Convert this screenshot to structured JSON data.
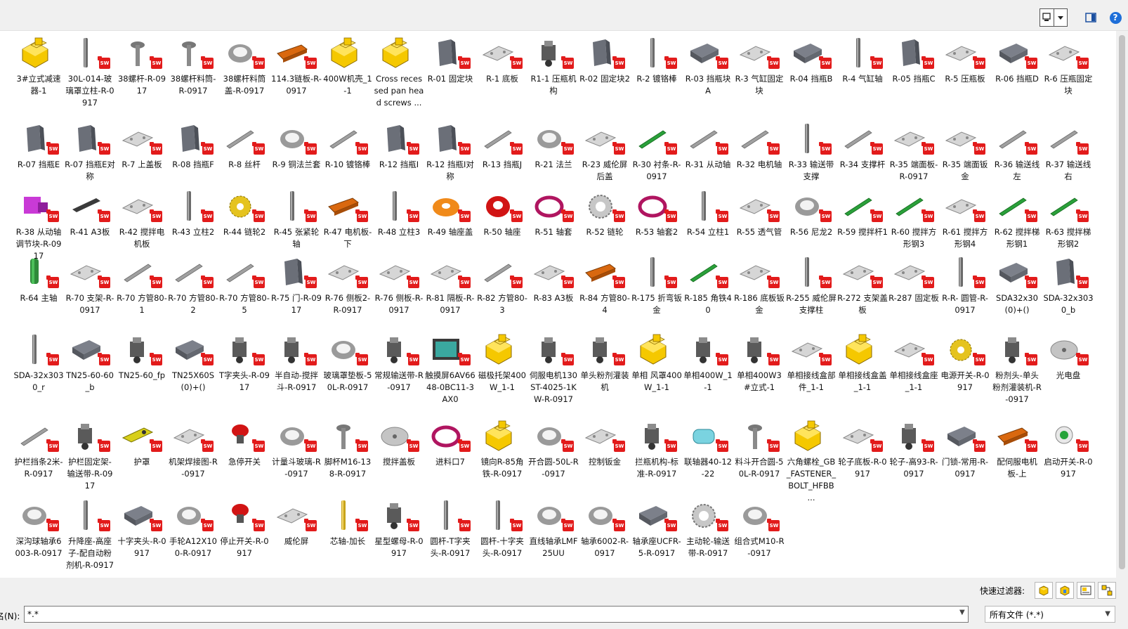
{
  "toolbar": {
    "view_icon": "view-mode-icon",
    "dropdown_icon": "chevron-down-icon",
    "preview_pane_icon": "preview-pane-icon",
    "help_label": "?"
  },
  "colors": {
    "sw_badge": "#e21b1b",
    "help": "#1e6fd9",
    "selection": "#ffffff"
  },
  "files": [
    {
      "name": "3#立式减速器-1",
      "kind": "asm"
    },
    {
      "name": "30L-014-玻璃罩立柱-R-0917",
      "kind": "rod"
    },
    {
      "name": "38螺杆-R-0917",
      "kind": "screw"
    },
    {
      "name": "38螺杆料筒-R-0917",
      "kind": "screw"
    },
    {
      "name": "38螺杆料筒盖-R-0917",
      "kind": "ring"
    },
    {
      "name": "114.3链板-R-0917",
      "kind": "orange"
    },
    {
      "name": "400W机壳_1-1",
      "kind": "asm"
    },
    {
      "name": "Cross recessed pan head screws ...",
      "kind": "asm"
    },
    {
      "name": "R-01 固定块",
      "kind": "block"
    },
    {
      "name": "R-1 底板",
      "kind": "plate"
    },
    {
      "name": "R1-1 压瓶机构",
      "kind": "mech"
    },
    {
      "name": "R-02 固定块2",
      "kind": "block"
    },
    {
      "name": "R-2 镀铬棒",
      "kind": "rod"
    },
    {
      "name": "R-03 挡瓶块A",
      "kind": "dark"
    },
    {
      "name": "R-3 气缸固定块",
      "kind": "plate"
    },
    {
      "name": "R-04 挡瓶B",
      "kind": "dark"
    },
    {
      "name": "R-4 气缸轴",
      "kind": "rod"
    },
    {
      "name": "R-05 挡瓶C",
      "kind": "block"
    },
    {
      "name": "R-5 压瓶板",
      "kind": "plate"
    },
    {
      "name": "R-06 挡瓶D",
      "kind": "dark"
    },
    {
      "name": "R-6 压瓶固定块",
      "kind": "plate"
    },
    {
      "name": "R-07 挡瓶E",
      "kind": "block"
    },
    {
      "name": "R-07 挡瓶E对称",
      "kind": "block"
    },
    {
      "name": "R-7 上盖板",
      "kind": "plate"
    },
    {
      "name": "R-08 挡瓶F",
      "kind": "block"
    },
    {
      "name": "R-8 丝杆",
      "kind": "bar"
    },
    {
      "name": "R-9 铜法兰套",
      "kind": "ring"
    },
    {
      "name": "R-10 镀铬棒",
      "kind": "bar"
    },
    {
      "name": "R-12 挡瓶I",
      "kind": "block"
    },
    {
      "name": "R-12 挡瓶I对称",
      "kind": "block"
    },
    {
      "name": "R-13 挡瓶J",
      "kind": "bar"
    },
    {
      "name": "R-21 法兰",
      "kind": "ring"
    },
    {
      "name": "R-23 威伦屏后盖",
      "kind": "plate"
    },
    {
      "name": "R-30 衬条-R-0917",
      "kind": "greenbar"
    },
    {
      "name": "R-31 从动轴",
      "kind": "bar"
    },
    {
      "name": "R-32 电机轴",
      "kind": "bar"
    },
    {
      "name": "R-33 输送带支撑",
      "kind": "rod"
    },
    {
      "name": "R-34 支撑杆",
      "kind": "bar"
    },
    {
      "name": "R-35 端面板-R-0917",
      "kind": "plate"
    },
    {
      "name": "R-35 端面钣金",
      "kind": "plate"
    },
    {
      "name": "R-36 输送线左",
      "kind": "bar"
    },
    {
      "name": "R-37 输送线右",
      "kind": "bar"
    },
    {
      "name": "R-38 从动轴调节块-R-0917",
      "kind": "purple"
    },
    {
      "name": "R-41 A3板",
      "kind": "darkbar"
    },
    {
      "name": "R-42 搅拌电机板",
      "kind": "plate"
    },
    {
      "name": "R-43 立柱2",
      "kind": "rod"
    },
    {
      "name": "R-44 链轮2",
      "kind": "yellowgear"
    },
    {
      "name": "R-45 张紧轮轴",
      "kind": "rod"
    },
    {
      "name": "R-47 电机板-下",
      "kind": "orange"
    },
    {
      "name": "R-48 立柱3",
      "kind": "rod"
    },
    {
      "name": "R-49 轴座盖",
      "kind": "orangering"
    },
    {
      "name": "R-50 轴座",
      "kind": "redring"
    },
    {
      "name": "R-51 轴套",
      "kind": "crimsonring"
    },
    {
      "name": "R-52 链轮",
      "kind": "gear"
    },
    {
      "name": "R-53 轴套2",
      "kind": "crimsonring"
    },
    {
      "name": "R-54 立柱1",
      "kind": "rod"
    },
    {
      "name": "R-55 透气管",
      "kind": "plate"
    },
    {
      "name": "R-56 尼龙2",
      "kind": "ring"
    },
    {
      "name": "R-59 搅拌杆1",
      "kind": "greenbar"
    },
    {
      "name": "R-60 搅拌方形钢3",
      "kind": "greenbar"
    },
    {
      "name": "R-61 搅拌方形钢4",
      "kind": "plate"
    },
    {
      "name": "R-62 搅拌梯形钢1",
      "kind": "greenbar"
    },
    {
      "name": "R-63 搅拌梯形钢2",
      "kind": "greenbar"
    },
    {
      "name": "R-64 主轴",
      "kind": "greenrod"
    },
    {
      "name": "R-70 支架-R-0917",
      "kind": "plate"
    },
    {
      "name": "R-70 方管80-1",
      "kind": "bar"
    },
    {
      "name": "R-70 方管80-2",
      "kind": "bar"
    },
    {
      "name": "R-70 方管80-5",
      "kind": "bar"
    },
    {
      "name": "R-75 门-R-0917",
      "kind": "block"
    },
    {
      "name": "R-76 侧板2-R-0917",
      "kind": "plate"
    },
    {
      "name": "R-76 侧板-R-0917",
      "kind": "plate"
    },
    {
      "name": "R-81 隔板-R-0917",
      "kind": "plate"
    },
    {
      "name": "R-82 方管80-3",
      "kind": "bar"
    },
    {
      "name": "R-83 A3板",
      "kind": "plate"
    },
    {
      "name": "R-84 方管80-4",
      "kind": "orange"
    },
    {
      "name": "R-175 折弯钣金",
      "kind": "rod"
    },
    {
      "name": "R-185 角铁40",
      "kind": "greenbar"
    },
    {
      "name": "R-186 底板钣金",
      "kind": "plate"
    },
    {
      "name": "R-255 威伦屏支撑柱",
      "kind": "rod"
    },
    {
      "name": "R-272 支架盖板",
      "kind": "plate"
    },
    {
      "name": "R-287 固定板",
      "kind": "plate"
    },
    {
      "name": "R-R- 圆管-R-0917",
      "kind": "rod"
    },
    {
      "name": "SDA32x30(0)+()",
      "kind": "dark"
    },
    {
      "name": "SDA-32x3030_b",
      "kind": "block"
    },
    {
      "name": "SDA-32x3030_r",
      "kind": "rod"
    },
    {
      "name": "TN25-60-60_b",
      "kind": "dark"
    },
    {
      "name": "TN25-60_fp",
      "kind": "mech"
    },
    {
      "name": "TN25X60S(0)+()",
      "kind": "dark"
    },
    {
      "name": "T字夹头-R-0917",
      "kind": "mech"
    },
    {
      "name": "半自动-搅拌斗-R-0917",
      "kind": "mech"
    },
    {
      "name": "玻璃罩垫板-50L-R-0917",
      "kind": "ring"
    },
    {
      "name": "常规输送带-R-0917",
      "kind": "mech"
    },
    {
      "name": "触摸屏6AV6648-0BC11-3AX0",
      "kind": "screen"
    },
    {
      "name": "磁极托架400W_1-1",
      "kind": "asm"
    },
    {
      "name": "伺服电机130ST-4025-1KW-R-0917",
      "kind": "mech"
    },
    {
      "name": "单头粉剂灌装机",
      "kind": "mech"
    },
    {
      "name": "单相 风罩400W_1-1",
      "kind": "asm"
    },
    {
      "name": "单相400W_1-1",
      "kind": "mech"
    },
    {
      "name": "单相400W3#立式-1",
      "kind": "mech"
    },
    {
      "name": "单相接线盒部件_1-1",
      "kind": "plate"
    },
    {
      "name": "单相接线盒盖_1-1",
      "kind": "asm"
    },
    {
      "name": "单相接线盒座_1-1",
      "kind": "plate"
    },
    {
      "name": "电源开关-R-0917",
      "kind": "yellowgear"
    },
    {
      "name": "粉剂头-单头粉剂灌装机-R-0917",
      "kind": "mech"
    },
    {
      "name": "光电盘",
      "kind": "disc"
    },
    {
      "name": "护栏挡条2米-R-0917",
      "kind": "bar"
    },
    {
      "name": "护栏固定架-输送带-R-0917",
      "kind": "mech"
    },
    {
      "name": "护罩",
      "kind": "yellowbar"
    },
    {
      "name": "机架焊接图-R-0917",
      "kind": "plate"
    },
    {
      "name": "急停开关",
      "kind": "redknob"
    },
    {
      "name": "计量斗玻璃-R-0917",
      "kind": "ring"
    },
    {
      "name": "脚杯M16-138-R-0917",
      "kind": "screw"
    },
    {
      "name": "搅拌盖板",
      "kind": "disc"
    },
    {
      "name": "进料口7",
      "kind": "crimsonring"
    },
    {
      "name": "镜向R-85角铁-R-0917",
      "kind": "asm"
    },
    {
      "name": "开合圆-50L-R-0917",
      "kind": "ring"
    },
    {
      "name": "控制钣金",
      "kind": "plate"
    },
    {
      "name": "拦瓶机构-标准-R-0917",
      "kind": "mech"
    },
    {
      "name": "联轴器40-12-22",
      "kind": "cyan"
    },
    {
      "name": "料斗开合圆-50L-R-0917",
      "kind": "screw"
    },
    {
      "name": "六角螺栓_GB_FASTENER_BOLT_HFBB ...",
      "kind": "asm"
    },
    {
      "name": "轮子底板-R-0917",
      "kind": "plate"
    },
    {
      "name": "轮子-高93-R-0917",
      "kind": "mech"
    },
    {
      "name": "门锁-常用-R-0917",
      "kind": "dark"
    },
    {
      "name": "配伺服电机板-上",
      "kind": "orange"
    },
    {
      "name": "启动开关-R-0917",
      "kind": "greenknob"
    },
    {
      "name": "深沟球轴承6003-R-0917",
      "kind": "ring"
    },
    {
      "name": "升降座-高座子-配自动粉剂机-R-0917",
      "kind": "rod"
    },
    {
      "name": "十字夹头-R-0917",
      "kind": "dark"
    },
    {
      "name": "手轮A12X100-R-0917",
      "kind": "ring"
    },
    {
      "name": "停止开关-R-0917",
      "kind": "redknob"
    },
    {
      "name": "威伦屏",
      "kind": "plate"
    },
    {
      "name": "芯轴-加长",
      "kind": "goldrod"
    },
    {
      "name": "星型螺母-R-0917",
      "kind": "mech"
    },
    {
      "name": "圆杆-T字夹头-R-0917",
      "kind": "rod"
    },
    {
      "name": "圆杆-十字夹头-R-0917",
      "kind": "rod"
    },
    {
      "name": "直线轴承LMF25UU",
      "kind": "ring"
    },
    {
      "name": "轴承6002-R-0917",
      "kind": "ring"
    },
    {
      "name": "轴承座UCFR-5-R-0917",
      "kind": "dark"
    },
    {
      "name": "主动轮-输送带-R-0917",
      "kind": "gear"
    },
    {
      "name": "组合式M10-R-0917",
      "kind": "ring"
    }
  ],
  "badge_text": "SW",
  "bottom": {
    "quick_filter_label": "快速过滤器:",
    "quick_filters": [
      "part-filter-icon",
      "assembly-filter-icon",
      "drawing-filter-icon",
      "top-level-filter-icon"
    ],
    "filename_label": "名(N):",
    "filename_value": "*.*",
    "filetype_value": "所有文件 (*.*)"
  }
}
